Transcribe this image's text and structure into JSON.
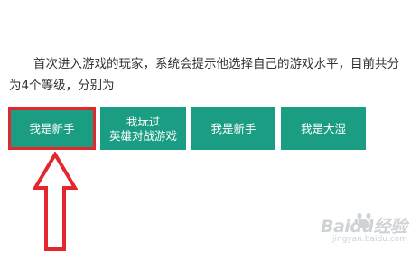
{
  "intro": {
    "text": "首次进入游戏的玩家，系统会提示他选择自己的游戏水平，目前共分为4个等级，分别为"
  },
  "levels": [
    {
      "label": "我是新手",
      "selected": true
    },
    {
      "label": "我玩过\n英雄对战游戏",
      "selected": false
    },
    {
      "label": "我是新手",
      "selected": false
    },
    {
      "label": "我是大湿",
      "selected": false
    }
  ],
  "colors": {
    "button_bg": "#1a9d82",
    "button_text": "#ffffff",
    "highlight": "#e2282c"
  },
  "annotation": {
    "icon": "up-arrow-icon"
  },
  "watermark": {
    "logo": "Baidu经验",
    "url": "jingyan.baidu.com"
  }
}
